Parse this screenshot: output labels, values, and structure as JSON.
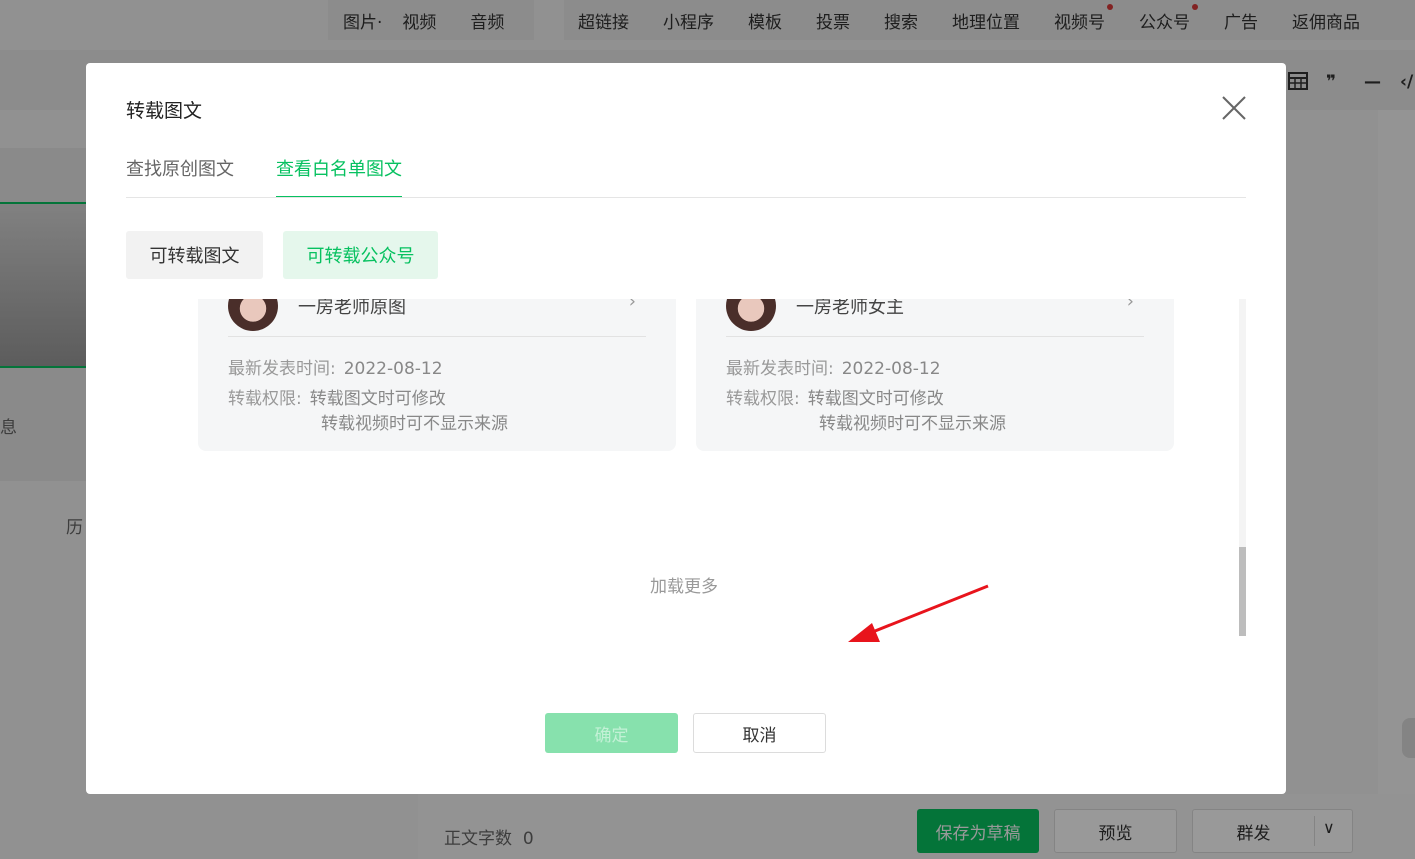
{
  "editor": {
    "insert_menu_group1": [
      "图片",
      "视频",
      "音频"
    ],
    "insert_menu_group2": [
      "超链接",
      "小程序",
      "模板",
      "投票",
      "搜索",
      "地理位置",
      "视频号",
      "公众号",
      "广告",
      "返佣商品"
    ],
    "image_caret": "·",
    "toolbar_icons": [
      "table-icon",
      "quote-icon",
      "divider-icon",
      "code-icon"
    ],
    "quote_glyph": "❞",
    "divider_glyph": "—",
    "code_glyph": "‹/",
    "left_text_partial_1": "息",
    "left_text_partial_2": "历",
    "word_count_label": "正文字数",
    "word_count": "0",
    "save_draft": "保存为草稿",
    "preview": "预览",
    "mass_send": "群发",
    "mass_send_caret": "∨"
  },
  "dialog": {
    "title": "转载图文",
    "tabs": [
      "查找原创图文",
      "查看白名单图文"
    ],
    "active_tab": 1,
    "subtabs": [
      "可转载图文",
      "可转载公众号"
    ],
    "active_subtab": 1,
    "cards": [
      {
        "name_partial": "一房老师原图",
        "publish_label": "最新发表时间:",
        "publish_date": "2022-08-12",
        "permission_label": "转载权限:",
        "permission_1": "转载图文时可修改",
        "permission_2": "转载视频时可不显示来源"
      },
      {
        "name_partial": "一房老师女主",
        "publish_label": "最新发表时间:",
        "publish_date": "2022-08-12",
        "permission_label": "转载权限:",
        "permission_1": "转载图文时可修改",
        "permission_2": "转载视频时可不显示来源"
      }
    ],
    "card_more_glyph": "›",
    "load_more": "加载更多",
    "confirm": "确定",
    "cancel": "取消",
    "colors": {
      "accent": "#07c160",
      "annotation_arrow": "#e8141c"
    }
  }
}
